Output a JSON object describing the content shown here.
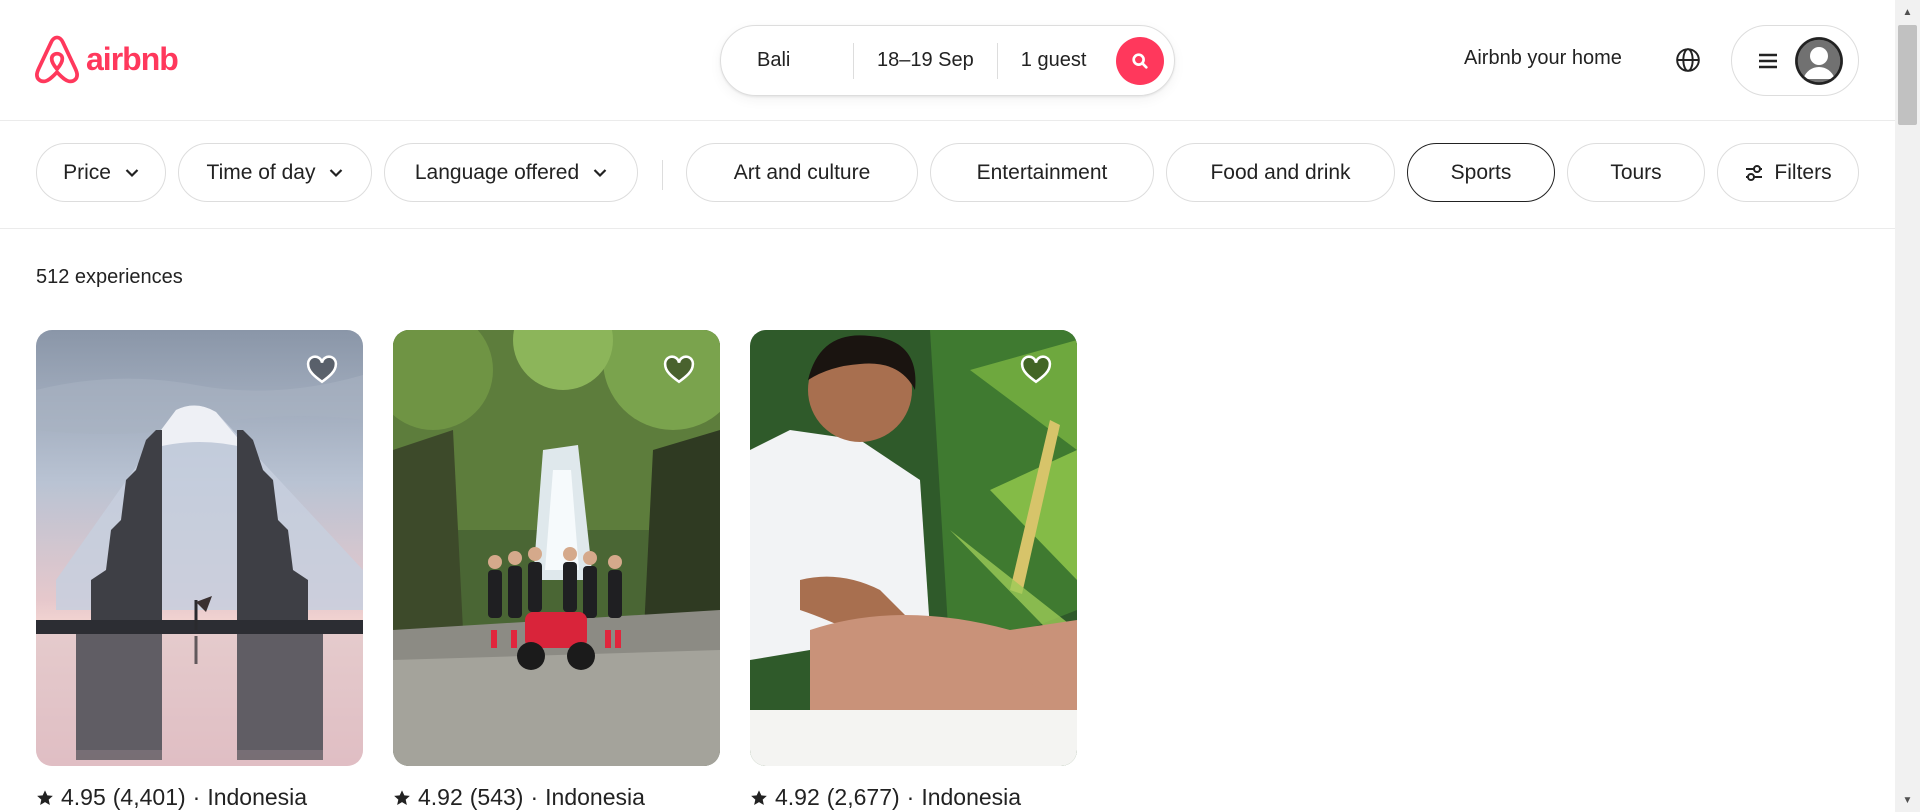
{
  "brand": {
    "name": "airbnb",
    "color": "#ff385c"
  },
  "search": {
    "location": "Bali",
    "dates": "18–19 Sep",
    "guests": "1 guest"
  },
  "header": {
    "host_link": "Airbnb your home"
  },
  "filters": {
    "dropdowns": [
      "Price",
      "Time of day",
      "Language offered"
    ],
    "categories": [
      "Art and culture",
      "Entertainment",
      "Food and drink",
      "Sports",
      "Tours"
    ],
    "selected_category": "Sports",
    "filters_label": "Filters"
  },
  "results": {
    "count_label": "512 experiences",
    "cards": [
      {
        "rating": "4.95",
        "reviews": "(4,401)",
        "separator": "·",
        "location": "Indonesia"
      },
      {
        "rating": "4.92",
        "reviews": "(543)",
        "separator": "·",
        "location": "Indonesia"
      },
      {
        "rating": "4.92",
        "reviews": "(2,677)",
        "separator": "·",
        "location": "Indonesia"
      }
    ]
  },
  "icons": {
    "logo": "airbnb-logo-icon",
    "search": "search-icon",
    "globe": "globe-icon",
    "menu": "hamburger-menu-icon",
    "avatar": "user-avatar-icon",
    "chevron": "chevron-down-icon",
    "filters": "sliders-icon",
    "heart": "heart-outline-icon",
    "star": "star-icon"
  }
}
